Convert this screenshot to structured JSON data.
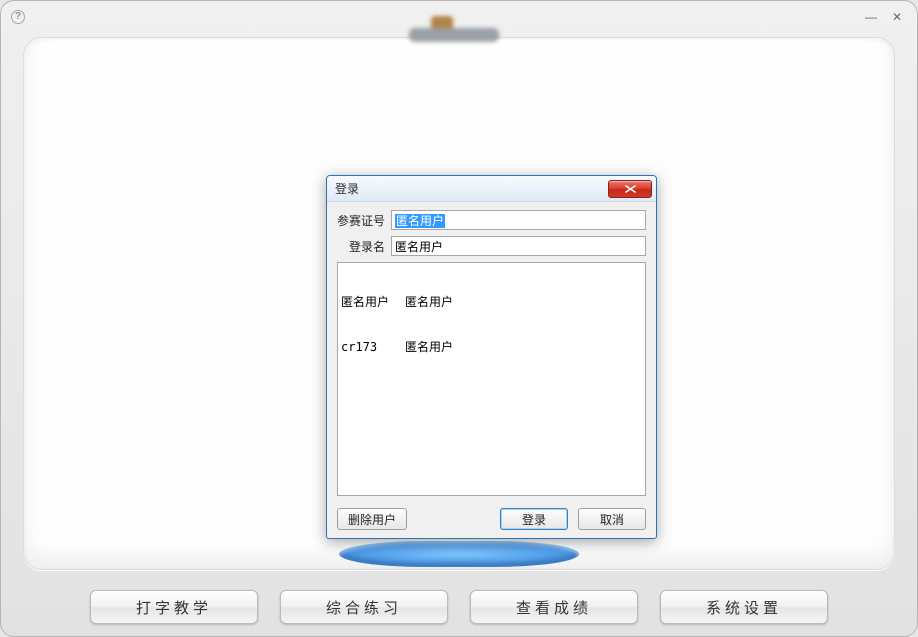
{
  "window": {
    "help_glyph": "?",
    "minimize_glyph": "—",
    "close_glyph": "✕"
  },
  "nav": {
    "items": [
      "打字教学",
      "综合练习",
      "查看成绩",
      "系统设置"
    ]
  },
  "dialog": {
    "title": "登录",
    "fields": {
      "id_label": "参赛证号",
      "id_value": "匿名用户",
      "name_label": "登录名",
      "name_value": "匿名用户"
    },
    "list": [
      {
        "col1": "匿名用户",
        "col2": "匿名用户"
      },
      {
        "col1": "cr173",
        "col2": "匿名用户"
      }
    ],
    "buttons": {
      "delete": "删除用户",
      "login": "登录",
      "cancel": "取消"
    }
  }
}
